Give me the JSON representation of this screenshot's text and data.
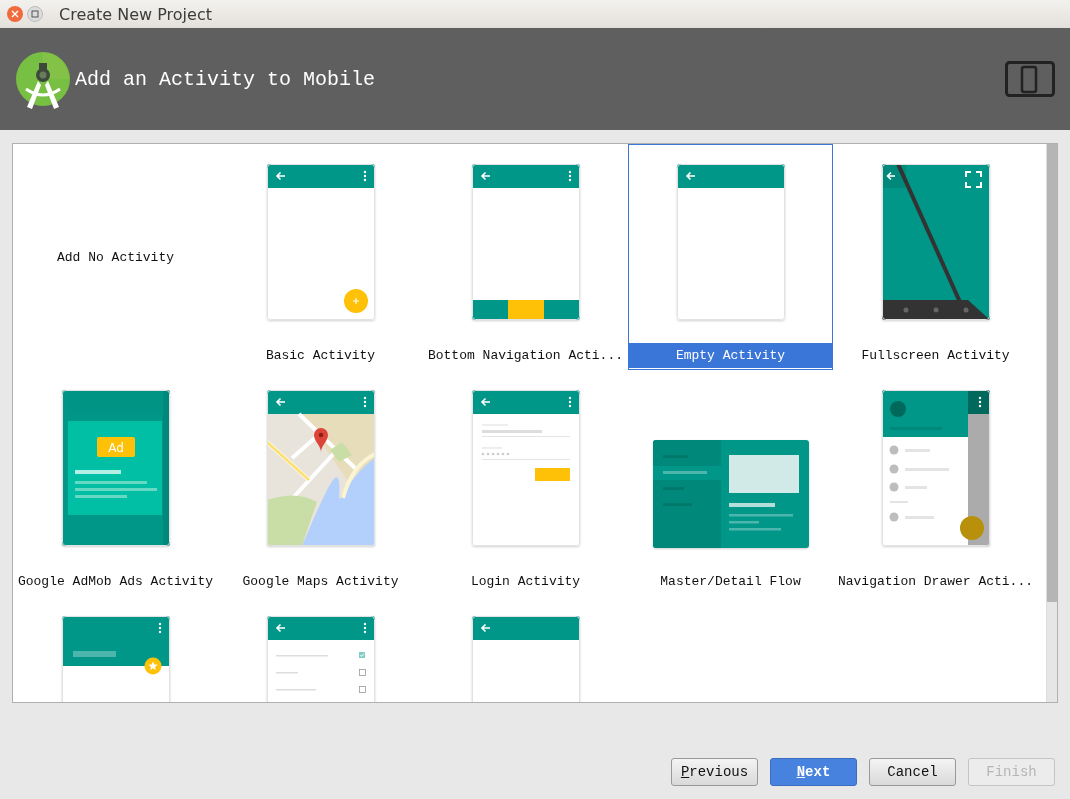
{
  "window": {
    "title": "Create New Project"
  },
  "header": {
    "title": "Add an Activity to Mobile"
  },
  "templates": [
    {
      "kind": "none",
      "label": "Add No Activity",
      "selected": false
    },
    {
      "kind": "basic",
      "label": "Basic Activity",
      "selected": false
    },
    {
      "kind": "bottom_nav",
      "label": "Bottom Navigation Acti...",
      "selected": false
    },
    {
      "kind": "empty",
      "label": "Empty Activity",
      "selected": true
    },
    {
      "kind": "fullscreen",
      "label": "Fullscreen Activity",
      "selected": false
    },
    {
      "kind": "admob",
      "label": "Google AdMob Ads Activity",
      "badge": "Ad",
      "selected": false
    },
    {
      "kind": "maps",
      "label": "Google Maps Activity",
      "selected": false
    },
    {
      "kind": "login",
      "label": "Login Activity",
      "selected": false
    },
    {
      "kind": "master_detail",
      "label": "Master/Detail Flow",
      "selected": false
    },
    {
      "kind": "nav_drawer",
      "label": "Navigation Drawer Acti...",
      "selected": false
    },
    {
      "kind": "scrolling",
      "selected": false
    },
    {
      "kind": "settings",
      "selected": false
    },
    {
      "kind": "empty",
      "selected": false
    }
  ],
  "buttons": [
    {
      "label": "Previous",
      "kind": "default",
      "mnemonic": true,
      "disabled": false
    },
    {
      "label": "Next",
      "kind": "primary",
      "mnemonic": true,
      "disabled": false
    },
    {
      "label": "Cancel",
      "kind": "default",
      "mnemonic": false,
      "disabled": false
    },
    {
      "label": "Finish",
      "kind": "default",
      "mnemonic": false,
      "disabled": true
    }
  ]
}
